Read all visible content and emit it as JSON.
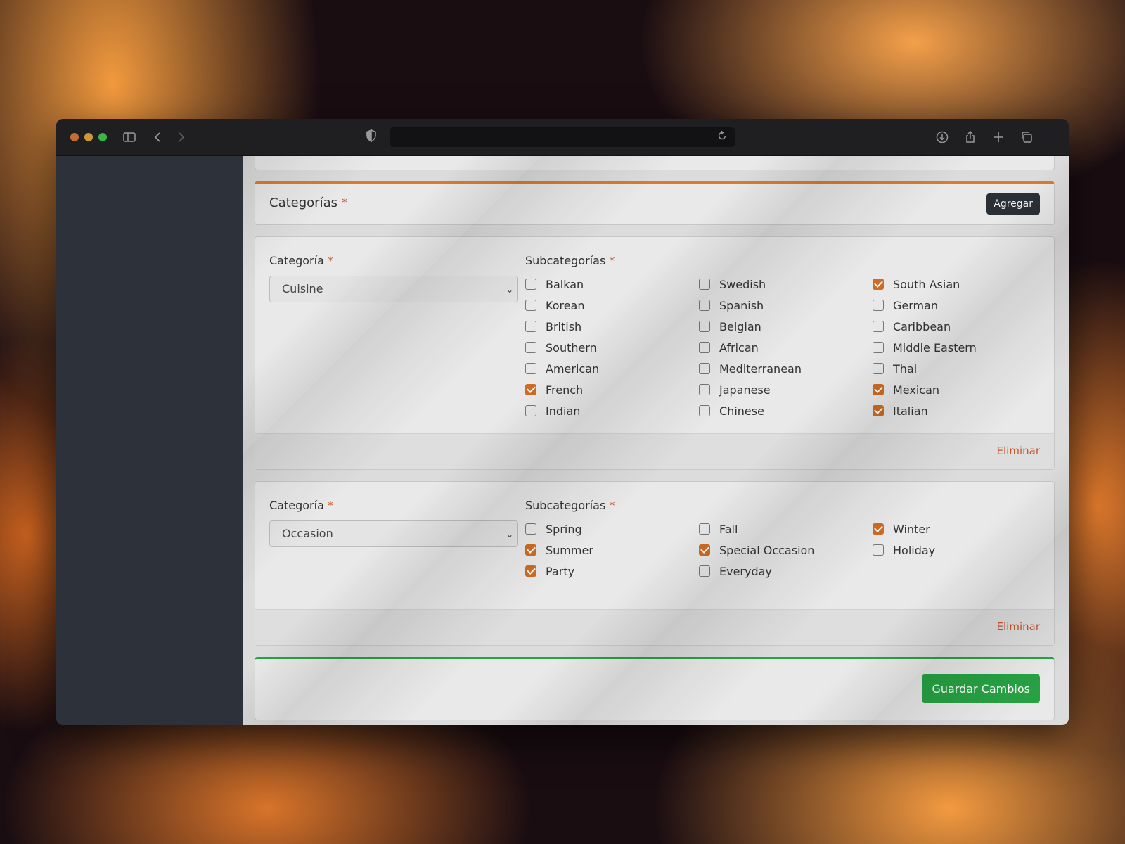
{
  "header": {
    "title": "Categorías",
    "required_mark": "*",
    "add_button": "Agregar"
  },
  "category_blocks": [
    {
      "category_label": "Categoría",
      "subcategories_label": "Subcategorías",
      "required_mark": "*",
      "selected": "Cuisine",
      "delete_label": "Eliminar",
      "subcategories": [
        {
          "label": "Balkan",
          "checked": false
        },
        {
          "label": "Korean",
          "checked": false
        },
        {
          "label": "British",
          "checked": false
        },
        {
          "label": "Southern",
          "checked": false
        },
        {
          "label": "American",
          "checked": false
        },
        {
          "label": "French",
          "checked": true
        },
        {
          "label": "Indian",
          "checked": false
        },
        {
          "label": "Swedish",
          "checked": false
        },
        {
          "label": "Spanish",
          "checked": false
        },
        {
          "label": "Belgian",
          "checked": false
        },
        {
          "label": "African",
          "checked": false
        },
        {
          "label": "Mediterranean",
          "checked": false
        },
        {
          "label": "Japanese",
          "checked": false
        },
        {
          "label": "Chinese",
          "checked": false
        },
        {
          "label": "South Asian",
          "checked": true
        },
        {
          "label": "German",
          "checked": false
        },
        {
          "label": "Caribbean",
          "checked": false
        },
        {
          "label": "Middle Eastern",
          "checked": false
        },
        {
          "label": "Thai",
          "checked": false
        },
        {
          "label": "Mexican",
          "checked": true
        },
        {
          "label": "Italian",
          "checked": true
        }
      ]
    },
    {
      "category_label": "Categoría",
      "subcategories_label": "Subcategorías",
      "required_mark": "*",
      "selected": "Occasion",
      "delete_label": "Eliminar",
      "subcategories": [
        {
          "label": "Spring",
          "checked": false
        },
        {
          "label": "Summer",
          "checked": true
        },
        {
          "label": "Party",
          "checked": true
        },
        {
          "label": "Fall",
          "checked": false
        },
        {
          "label": "Special Occasion",
          "checked": true
        },
        {
          "label": "Everyday",
          "checked": false
        },
        {
          "label": "Winter",
          "checked": true
        },
        {
          "label": "Holiday",
          "checked": false
        }
      ]
    }
  ],
  "save_button": "Guardar Cambios",
  "colors": {
    "accent_orange": "#cf6b22",
    "save_green": "#27a243",
    "danger": "#c8552a"
  }
}
